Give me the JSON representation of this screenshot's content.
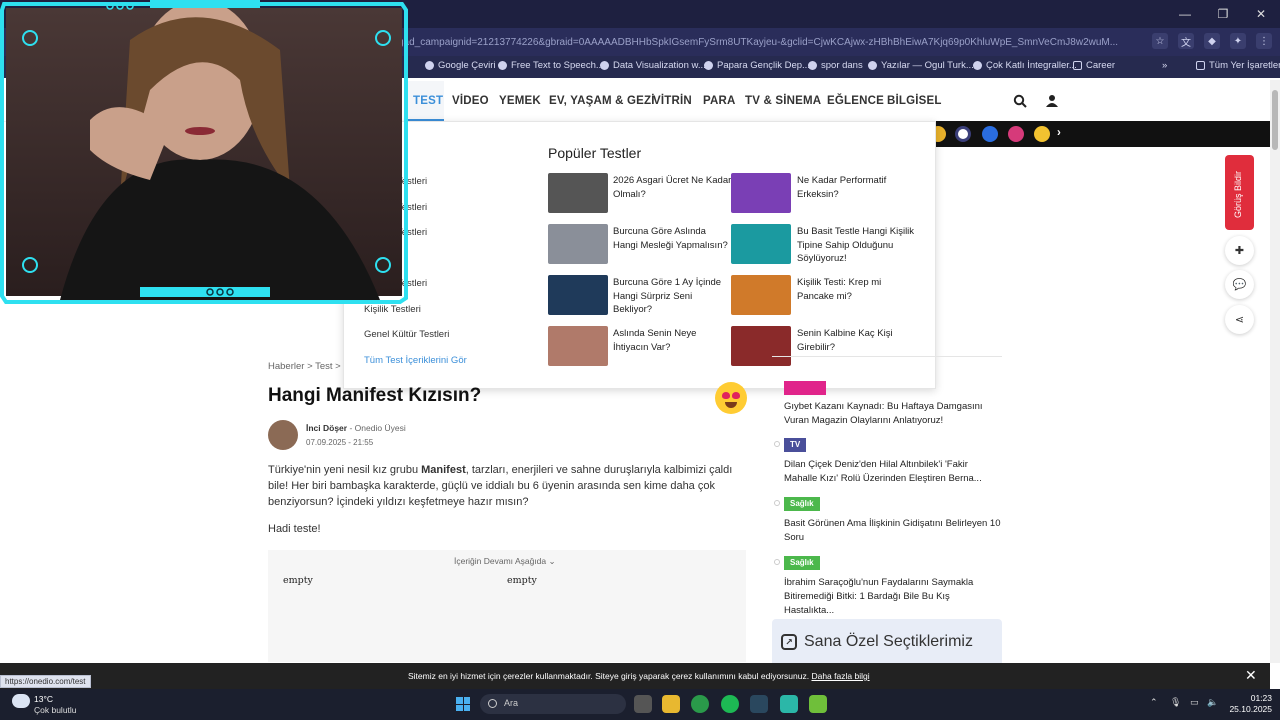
{
  "browser": {
    "url": "gad_campaignid=21213774226&gbraid=0AAAAADBHHbSpkIGsemFySrm8UTKayjeu-&gclid=CjwKCAjwx-zHBhBhEiwA7Kjq69p0KhluWpE_SmnVeCmJ8w2wuM...",
    "bookmarks": [
      "Google Çeviri",
      "Free Text to Speech...",
      "Data Visualization w...",
      "Papara Gençlik Dep...",
      "spor dans",
      "Yazılar — Ogul Turk...",
      "Çok Katlı İntegraller...",
      "Career",
      "»",
      "Tüm Yer İşaretleri"
    ],
    "status_url": "https://onedio.com/test"
  },
  "nav": {
    "items": [
      "TEST",
      "VİDEO",
      "YEMEK",
      "EV, YAŞAM & GEZİ",
      "VİTRİN",
      "PARA",
      "TV & SİNEMA",
      "EĞLENCE",
      "BİLGİSEL"
    ],
    "active": "TEST"
  },
  "mega_menu": {
    "links": [
      "Testleri",
      "Testleri",
      "Testleri",
      "Testleri",
      "Kişilik Testleri",
      "Genel Kültür Testleri",
      "Tüm Test İçeriklerini Gör"
    ],
    "popular_title": "Popüler Testler",
    "tests": [
      {
        "title": "2026 Asgari Ücret Ne Kadar Olmalı?",
        "thumb_color": "#555"
      },
      {
        "title": "Ne Kadar Performatif Erkeksin?",
        "thumb_color": "#7a3fb5"
      },
      {
        "title": "Burcuna Göre Aslında Hangi Mesleği Yapmalısın?",
        "thumb_color": "#8a8f99"
      },
      {
        "title": "Bu Basit Testle Hangi Kişilik Tipine Sahip Olduğunu Söylüyoruz!",
        "thumb_color": "#1b9aa0"
      },
      {
        "title": "Burcuna Göre 1 Ay İçinde Hangi Sürpriz Seni Bekliyor?",
        "thumb_color": "#1f3a5a"
      },
      {
        "title": "Kişilik Testi: Krep mi Pancake mi?",
        "thumb_color": "#d07a2a"
      },
      {
        "title": "Aslında Senin Neye İhtiyacın Var?",
        "thumb_color": "#b07a6a"
      },
      {
        "title": "Senin Kalbine Kaç Kişi Girebilir?",
        "thumb_color": "#8a2a2a"
      }
    ]
  },
  "article": {
    "breadcrumb": "Haberler > Test >",
    "title": "Hangi Manifest Kızısın?",
    "author": "İnci Döşer",
    "author_role": "- Onedio Üyesi",
    "date": "07.09.2025 - 21:55",
    "p1_pre": "Türkiye'nin yeni nesil kız grubu ",
    "p1_bold": "Manifest",
    "p1_post": ", tarzları, enerjileri ve sahne duruşlarıyla kalbimizi çaldı bile! Her biri bambaşka karakterde, güçlü ve iddialı bu 6 üyenin arasında sen kime daha çok benziyorsun? İçindeki yıldızı keşfetmeye hazır mısın?",
    "p2": "Hadi teste!",
    "continue_label": "İçeriğin Devamı Aşağıda ⌄",
    "empty1": "empty",
    "empty2": "empty"
  },
  "sidebar": {
    "news": [
      {
        "tag": "",
        "tag_color": "#e0248a",
        "title": "Gıybet Kazanı Kaynadı: Bu Haftaya Damgasını Vuran Magazin Olaylarını Anlatıyoruz!"
      },
      {
        "tag": "TV",
        "tag_color": "#4a4f9a",
        "title": "Dilan Çiçek Deniz'den Hilal Altınbilek'i 'Fakir Mahalle Kızı' Rolü Üzerinden Eleştiren Berna..."
      },
      {
        "tag": "Sağlık",
        "tag_color": "#4cb84c",
        "title": "Basit Görünen Ama İlişkinin Gidişatını Belirleyen 10 Soru"
      },
      {
        "tag": "Sağlık",
        "tag_color": "#4cb84c",
        "title": "İbrahim Saraçoğlu'nun Faydalarını Saymakla Bitiremediği Bitki: 1 Bardağı Bile Bu Kış Hastalıkta..."
      }
    ],
    "special_title": "Sana Özel Seçtiklerimiz",
    "feedback_label": "Görüş Bildir"
  },
  "cookie": {
    "text": "Sitemiz en iyi hizmet için çerezler kullanmaktadır. Siteye giriş yaparak çerez kullanımını kabul ediyorsunuz.",
    "link": "Daha fazla bilgi"
  },
  "taskbar": {
    "temp": "13°C",
    "weather": "Çok bulutlu",
    "search": "Ara",
    "time": "01:23",
    "date": "25.10.2025"
  }
}
